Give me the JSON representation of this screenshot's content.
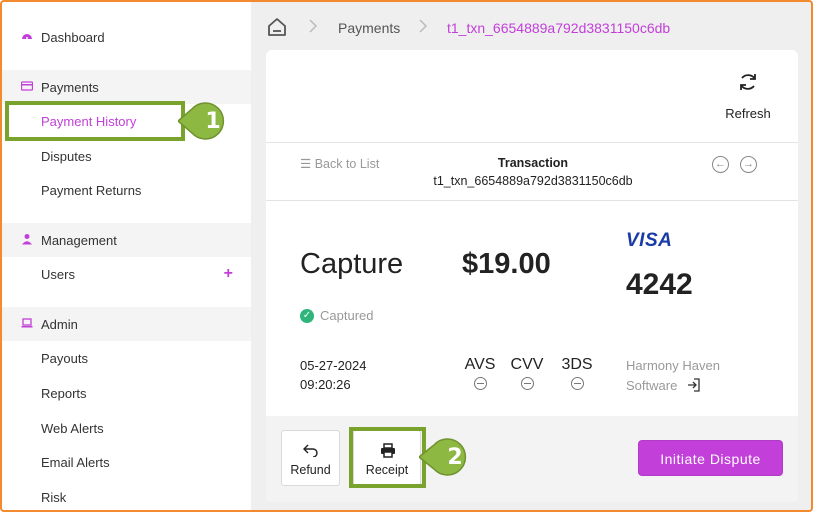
{
  "sidebar": {
    "items": [
      {
        "label": "Dashboard",
        "icon": "dashboard-icon"
      },
      {
        "label": "Payments",
        "icon": "credit-card-icon"
      },
      {
        "label": "Payment History"
      },
      {
        "label": "Disputes"
      },
      {
        "label": "Payment Returns"
      },
      {
        "label": "Management",
        "icon": "person-icon"
      },
      {
        "label": "Users",
        "add": "+"
      },
      {
        "label": "Admin",
        "icon": "laptop-icon"
      },
      {
        "label": "Payouts"
      },
      {
        "label": "Reports"
      },
      {
        "label": "Web Alerts"
      },
      {
        "label": "Email Alerts"
      },
      {
        "label": "Risk"
      }
    ]
  },
  "breadcrumb": {
    "home_icon": "home-icon",
    "section": "Payments",
    "current": "t1_txn_6654889a792d3831150c6db"
  },
  "card": {
    "refresh_label": "Refresh",
    "back_to_list": "Back to List",
    "transaction_title": "Transaction",
    "transaction_id": "t1_txn_6654889a792d3831150c6db",
    "type": "Capture",
    "amount": "$19.00",
    "card_brand": "VISA",
    "card_last4": "4242",
    "status": "Captured",
    "date": "05-27-2024",
    "time": "09:20:26",
    "checks": [
      {
        "label": "AVS"
      },
      {
        "label": "CVV"
      },
      {
        "label": "3DS"
      }
    ],
    "merchant_line1": "Harmony Haven",
    "merchant_line2": "Software"
  },
  "footer": {
    "refund_label": "Refund",
    "receipt_label": "Receipt",
    "dispute_label": "Initiate Dispute"
  },
  "callouts": {
    "one": "1",
    "two": "2"
  },
  "colors": {
    "accent": "#c23fd9",
    "highlight": "#7aa32e",
    "frame": "#f28a2e",
    "visa": "#1a3aa6",
    "success": "#2db57a"
  }
}
